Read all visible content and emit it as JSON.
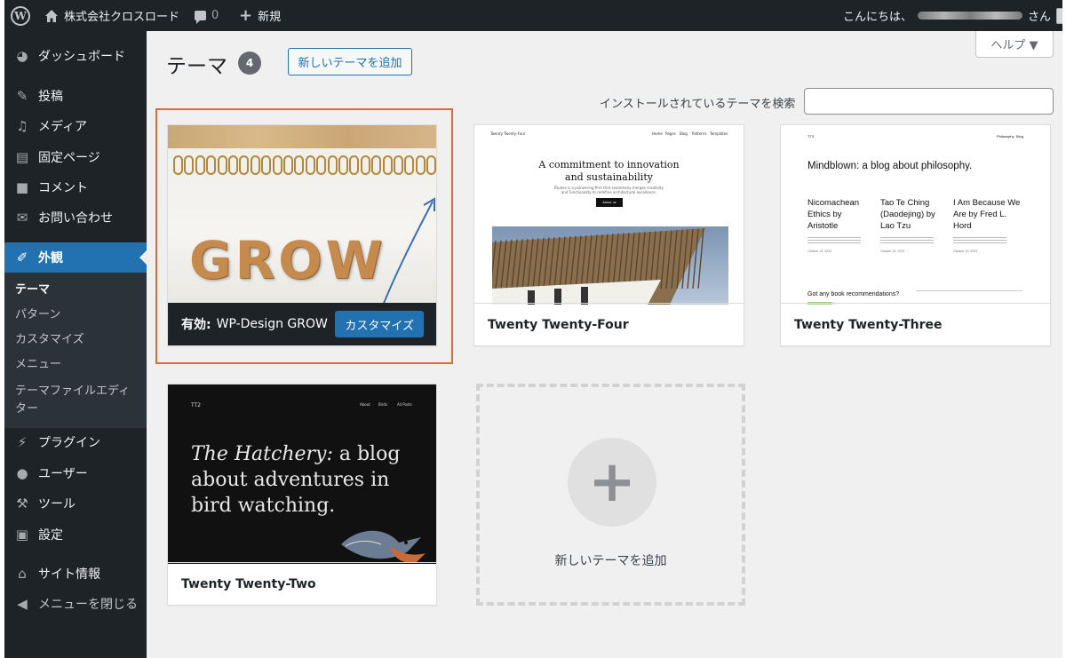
{
  "colors": {
    "admin_dark": "#1d2327",
    "accent_blue": "#2271b1",
    "page_bg": "#f0f0f1",
    "highlight_outline": "#e0693a"
  },
  "adminbar": {
    "site_icon": "home-icon",
    "site_name": "株式会社クロスロード",
    "comments_count": "0",
    "new_label": "新規",
    "greeting": "こんにちは、",
    "greeting_suffix": "さん"
  },
  "sidebar": {
    "items": [
      {
        "label": "ダッシュボード",
        "icon": "dashboard-icon"
      },
      {
        "label": "投稿",
        "icon": "pin-icon"
      },
      {
        "label": "メディア",
        "icon": "media-icon"
      },
      {
        "label": "固定ページ",
        "icon": "page-icon"
      },
      {
        "label": "コメント",
        "icon": "comment-icon"
      },
      {
        "label": "お問い合わせ",
        "icon": "mail-icon"
      },
      {
        "label": "外観",
        "icon": "brush-icon"
      },
      {
        "label": "プラグイン",
        "icon": "plugin-icon"
      },
      {
        "label": "ユーザー",
        "icon": "user-icon"
      },
      {
        "label": "ツール",
        "icon": "wrench-icon"
      },
      {
        "label": "設定",
        "icon": "settings-icon"
      },
      {
        "label": "サイト情報",
        "icon": "home-icon"
      },
      {
        "label": "メニューを閉じる",
        "icon": "collapse-icon"
      }
    ],
    "submenu": [
      {
        "label": "テーマ"
      },
      {
        "label": "パターン"
      },
      {
        "label": "カスタマイズ"
      },
      {
        "label": "メニュー"
      },
      {
        "label": "テーマファイルエディ"
      },
      {
        "label": "ター"
      }
    ]
  },
  "main": {
    "title": "テーマ",
    "count": "4",
    "add_new_label": "新しいテーマを追加",
    "help_label": "ヘルプ ▼",
    "search_label": "インストールされているテーマを検索",
    "search_value": ""
  },
  "themes": [
    {
      "active_prefix": "有効:",
      "name": "WP-Design GROW",
      "customize_label": "カスタマイズ",
      "screenshot_text": "GROW"
    },
    {
      "name": "Twenty Twenty-Four",
      "screenshot": {
        "site": "Twenty Twenty-Four",
        "nav": [
          "Home",
          "Pages",
          "Blog",
          "Patterns",
          "Templates"
        ],
        "heading_1": "A commitment to innovation",
        "heading_2": "and sustainability",
        "sub_1": "Études is a pioneering firm that seamlessly merges creativity",
        "sub_2": "and functionality to redefine architectural excellence.",
        "button": "About us"
      }
    },
    {
      "name": "Twenty Twenty-Three",
      "screenshot": {
        "site": "TT3",
        "nav": [
          "Philosophy",
          "Blog"
        ],
        "heading": "Mindblown: a blog about philosophy.",
        "posts": [
          [
            "Nicomachean",
            "Ethics by",
            "Aristotle"
          ],
          [
            "Tao Te Ching",
            "(Daodejing) by",
            "Lao Tzu"
          ],
          [
            "I Am Because We",
            "Are by Fred L.",
            "Hord"
          ]
        ],
        "dates": [
          "October 15, 2023",
          "October 15, 2023",
          "October 15, 2023"
        ],
        "footer": "Got any book recommendations?"
      }
    },
    {
      "name": "Twenty Twenty-Two",
      "screenshot": {
        "logo": "TT2",
        "nav": [
          "About",
          "Birds",
          "All Posts"
        ],
        "text_em": "The Hatchery:",
        "text_rest": " a blog about adventures in bird watching."
      }
    }
  ],
  "add_theme_tile": {
    "label": "新しいテーマを追加",
    "icon": "plus-icon"
  }
}
